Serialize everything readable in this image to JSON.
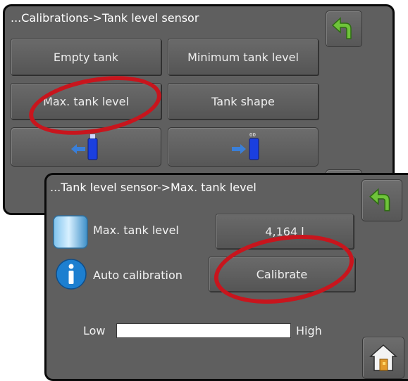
{
  "calibration_screen": {
    "title": "...Calibrations->Tank level sensor",
    "buttons": {
      "empty_tank": "Empty tank",
      "minimum_tank_level": "Minimum tank level",
      "max_tank_level": "Max. tank level",
      "tank_shape": "Tank shape"
    },
    "small_tank_label": "00"
  },
  "max_level_screen": {
    "title": "...Tank level sensor->Max. tank level",
    "max_tank_level_label": "Max. tank level",
    "max_tank_level_value": "4,164 l",
    "auto_calibration_label": "Auto calibration",
    "calibrate_button": "Calibrate",
    "slider": {
      "low_label": "Low",
      "high_label": "High",
      "fill_fraction": 0
    }
  },
  "icons": [
    "back-arrow-icon",
    "home-icon",
    "tank-icon",
    "info-icon"
  ],
  "colors": {
    "panel": "#5f5f5f",
    "annotation_ring": "#c8151d",
    "back_arrow": "#6fc43a",
    "info_blue": "#1d7fd0"
  }
}
